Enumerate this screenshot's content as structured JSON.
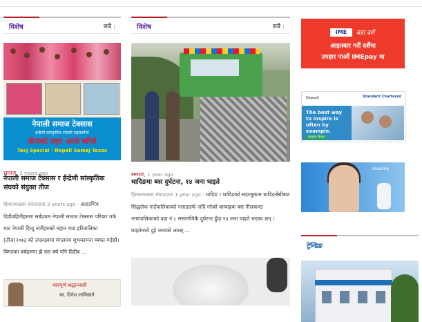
{
  "sections": [
    {
      "title": "विशेष",
      "more_label": "सबै :"
    },
    {
      "title": "विशेष",
      "more_label": "सबै :"
    }
  ],
  "article1": {
    "image_banner": {
      "title": "नेपाली समाज टेक्सास",
      "subtitle": "इन्द्रेणी सांस्कृतिक संघको सहकार्यमा",
      "red_text": "तीजको लहर आयो बरिले",
      "english_text": "Teej Special · Nepali Samaj Texas"
    },
    "category": "समाज",
    "time": "3 years ago",
    "title": "नेपाली समाज टेक्सास र ईन्द्रेणी सांस्कृतिक संघको संयुक्त तीज",
    "author": "हिमालयखबर संवाददाता",
    "author_time": "3 years ago -",
    "excerpt": "आदरणिय दिदीबहिनीहरुमा सर्बप्रथम नेपाली समाज टेक्सास परिवार तर्फ बाट नेपाली हिन्दु नारीहरुको महान चाड हरितालिका (तीज)२०७३ को उपलक्ष्यमा मंगलमय शुभकामना ब्यक्त गर्दछौ। बिगतका बर्षहरुमा झै यस बर्ष पनि दिदीब ..."
  },
  "article2": {
    "category": "समाज",
    "time": "1 year ago",
    "title": "धादिङमा बस दुर्घटना, १४ जना घाइते",
    "author": "हिमालयखबर संवाददाता",
    "author_time": "1 year ago -",
    "excerpt": "धादिङ । धादिङको सदरमुकाम धादिङबेंसीबाट सिद्धलेक गाउँपालिकाको नलाङतर्फ जाँदै गरेको वाग्वाहक बस नीलकण्ठ नगरपालिकाको वडा नं ८ ससानजिकै दुर्घटना हुँदा १४ जना घाइते भएका छन् । घाइतेमध्ये दुई जनाको अवस् ..."
  },
  "bottom_thumb1": {
    "label_red": "भावपूर्ण श्रद्धाञ्जली",
    "label": "स्व. दिनेश लामिछाने"
  },
  "ads": {
    "ime": {
      "logo": "IME",
      "festival": "बडा दशैं",
      "line1": "आइतबार गरौं दशैंमा",
      "line2": "उपहार पाऔं IMEpay मा"
    },
    "standard_chartered": {
      "corner": "Deposit",
      "brand": "Standard Chartered",
      "tagline": "The best way to inspire is often by example.",
      "cta": "Apply Now"
    },
    "vaseline": {
      "brand": "Vaseline"
    }
  },
  "trending": {
    "title": "ट्रेन्डिङ"
  },
  "colors": {
    "accent_red": "#b51f24",
    "section_purple": "#5a2ea6",
    "trend_blue": "#1a5fae"
  }
}
